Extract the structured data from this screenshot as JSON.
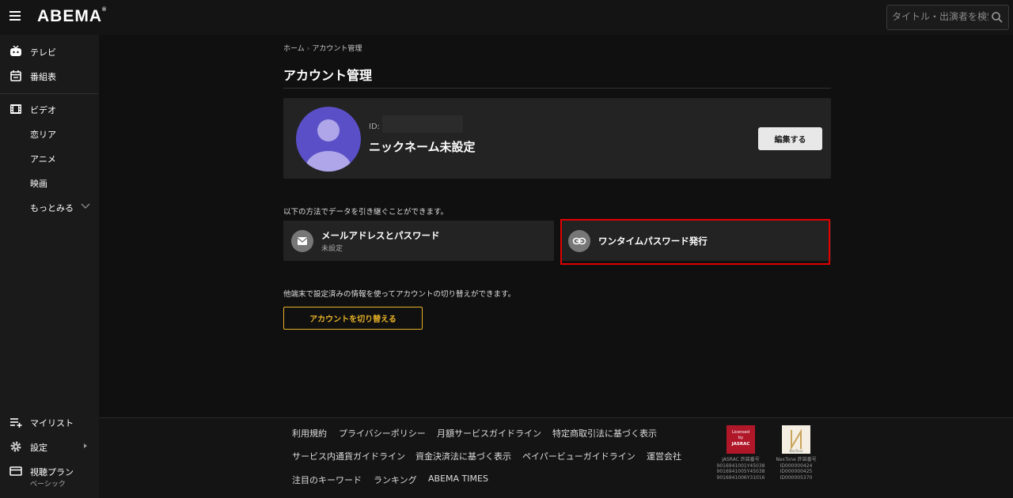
{
  "header": {
    "logo": "ABEMA",
    "search_placeholder": "タイトル・出演者を検索"
  },
  "sidebar": {
    "items": [
      {
        "label": "テレビ",
        "icon": "tv-icon"
      },
      {
        "label": "番組表",
        "icon": "calendar-icon"
      },
      {
        "label": "ビデオ",
        "icon": "film-icon"
      },
      {
        "label": "恋リア"
      },
      {
        "label": "アニメ"
      },
      {
        "label": "映画"
      },
      {
        "label": "もっとみる",
        "icon": "chevron-down-icon"
      }
    ],
    "bottom": [
      {
        "label": "マイリスト",
        "icon": "playlist-icon"
      },
      {
        "label": "設定",
        "icon": "gear-icon"
      },
      {
        "label": "視聴プラン",
        "sub": "ベーシック",
        "icon": "card-icon"
      }
    ]
  },
  "main": {
    "breadcrumb": [
      "ホーム",
      "アカウント管理"
    ],
    "title": "アカウント管理",
    "profile": {
      "id_label": "ID:",
      "nickname": "ニックネーム未設定",
      "edit_label": "編集する"
    },
    "transfer_info": "以下の方法でデータを引き継ぐことができます。",
    "methods": [
      {
        "title": "メールアドレスとパスワード",
        "status": "未設定",
        "icon": "mail-icon"
      },
      {
        "title": "ワンタイムパスワード発行",
        "icon": "link-icon"
      }
    ],
    "switch_info": "他端末で設定済みの情報を使ってアカウントの切り替えができます。",
    "switch_label": "アカウントを切り替える"
  },
  "footer": {
    "links_row1": [
      "利用規約",
      "プライバシーポリシー",
      "月額サービスガイドライン",
      "特定商取引法に基づく表示"
    ],
    "links_row2": [
      "サービス内通貨ガイドライン",
      "資金決済法に基づく表示",
      "ペイパービューガイドライン",
      "運営会社"
    ],
    "links_row3": [
      "注目のキーワード",
      "ランキング",
      "ABEMA TIMES"
    ],
    "jasrac": {
      "logo_text": "Licensed by JASRAC",
      "title": "JASRAC 許諾番号",
      "numbers": [
        "9016941001Y45038",
        "9016941005Y45038",
        "9016941006Y31016"
      ]
    },
    "nextone": {
      "logo_text": "NexTone",
      "title": "NexTone 許諾番号",
      "numbers": [
        "ID000000424",
        "ID000000425",
        "ID000005370"
      ]
    }
  }
}
